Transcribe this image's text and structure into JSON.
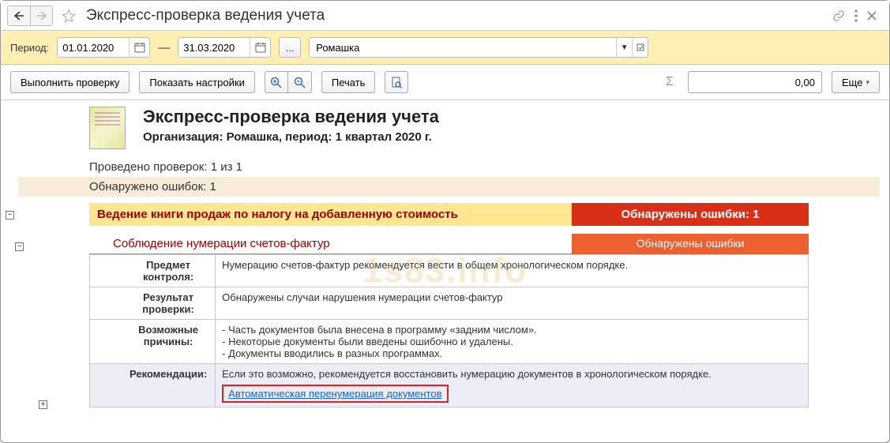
{
  "title": "Экспресс-проверка ведения учета",
  "filters": {
    "period_label": "Период:",
    "date_from": "01.01.2020",
    "date_to": "31.03.2020",
    "org": "Ромашка"
  },
  "toolbar": {
    "run_check": "Выполнить проверку",
    "show_settings": "Показать настройки",
    "print": "Печать",
    "sum_value": "0,00",
    "more": "Еще"
  },
  "report": {
    "h1": "Экспресс-проверка ведения учета",
    "h2": "Организация: Ромашка, период: 1 квартал 2020 г.",
    "checks_done": "Проведено проверок: 1 из 1",
    "errors_found": "Обнаружено ошибок: 1",
    "section": {
      "title": "Ведение книги продаж по налогу на добавленную стоимость",
      "status": "Обнаружены ошибки: 1",
      "sub_title": "Соблюдение нумерации счетов-фактур",
      "sub_status": "Обнаружены ошибки",
      "rows": {
        "subject_label": "Предмет контроля:",
        "subject_text": "Нумерацию счетов-фактур рекомендуется вести в общем хронологическом порядке.",
        "result_label": "Результат проверки:",
        "result_text": "Обнаружены случаи нарушения нумерации счетов-фактур",
        "reasons_label": "Возможные причины:",
        "reasons_text": "- Часть документов была внесена в программу «задним числом».\n- Некоторые документы были введены ошибочно и удалены.\n- Документы вводились в разных программах.",
        "recs_label": "Рекомендации:",
        "recs_text": "Если это возможно, рекомендуется восстановить нумерацию документов в хронологическом порядке.",
        "link": "Автоматическая перенумерация документов"
      }
    }
  },
  "watermark": "1s83.info"
}
